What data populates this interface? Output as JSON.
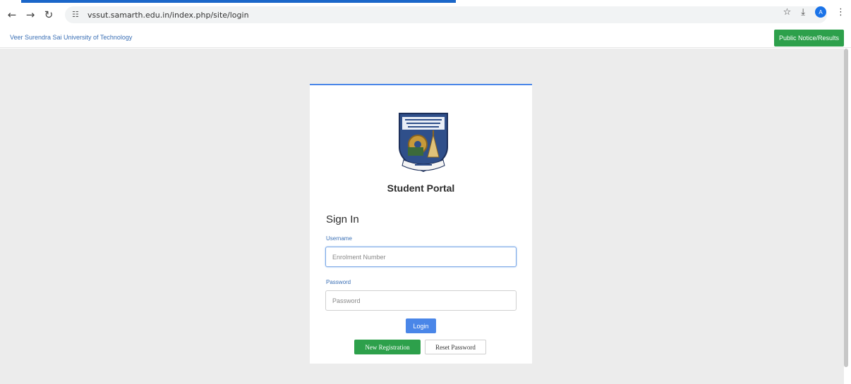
{
  "browser": {
    "url": "vssut.samarth.edu.in/index.php/site/login",
    "avatar_letter": "A",
    "icons": [
      "back-icon",
      "forward-icon",
      "reload-icon",
      "site-info-icon",
      "star-icon",
      "download-icon",
      "profile-avatar",
      "kebab-menu-icon"
    ]
  },
  "header": {
    "university_name": "Veer Surendra Sai University of Technology",
    "notice_button": "Public Notice/Results"
  },
  "login": {
    "portal_title": "Student Portal",
    "heading": "Sign In",
    "username_label": "Username",
    "username_placeholder": "Enrolment Number",
    "password_label": "Password",
    "password_placeholder": "Password",
    "login_button": "Login",
    "new_registration_button": "New Registration",
    "reset_password_button": "Reset Password"
  },
  "colors": {
    "primary_blue": "#4a86e8",
    "success_green": "#2da04b",
    "page_background": "#ececec",
    "link_blue": "#3a6fb5"
  }
}
